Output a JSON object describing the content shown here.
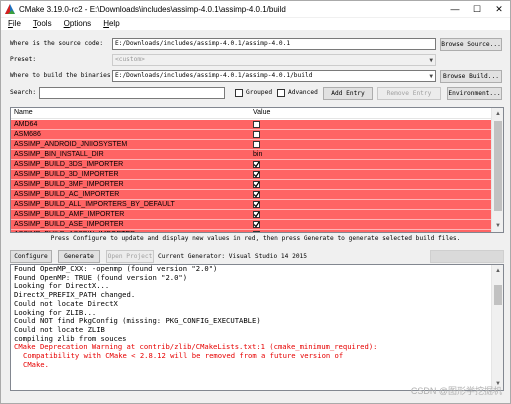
{
  "window": {
    "title": "CMake 3.19.0-rc2 - E:\\Downloads\\includes\\assimp-4.0.1\\assimp-4.0.1/build",
    "minimize": "—",
    "maximize": "☐",
    "close": "✕"
  },
  "menu": [
    {
      "label": "File",
      "key": "F",
      "rest": "ile"
    },
    {
      "label": "Tools",
      "key": "T",
      "rest": "ools"
    },
    {
      "label": "Options",
      "key": "O",
      "rest": "ptions"
    },
    {
      "label": "Help",
      "key": "H",
      "rest": "elp"
    }
  ],
  "source": {
    "label": "Where is the source code:",
    "value": "E:/Downloads/includes/assimp-4.0.1/assimp-4.0.1",
    "browse": "Browse Source..."
  },
  "preset": {
    "label": "Preset:",
    "value": "<custom>"
  },
  "build": {
    "label": "Where to build the binaries:",
    "value": "E:/Downloads/includes/assimp-4.0.1/assimp-4.0.1/build",
    "browse": "Browse Build..."
  },
  "search": {
    "label": "Search:",
    "value": "",
    "grouped": "Grouped",
    "advanced": "Advanced",
    "add_entry": "Add Entry",
    "remove_entry": "Remove Entry",
    "environment": "Environment..."
  },
  "table": {
    "col_name": "Name",
    "col_value": "Value",
    "rows": [
      {
        "name": "AMD64",
        "type": "check",
        "checked": false
      },
      {
        "name": "ASM686",
        "type": "check",
        "checked": false
      },
      {
        "name": "ASSIMP_ANDROID_JNIIOSYSTEM",
        "type": "check",
        "checked": false
      },
      {
        "name": "ASSIMP_BIN_INSTALL_DIR",
        "type": "text",
        "value": "bin"
      },
      {
        "name": "ASSIMP_BUILD_3DS_IMPORTER",
        "type": "check",
        "checked": true
      },
      {
        "name": "ASSIMP_BUILD_3D_IMPORTER",
        "type": "check",
        "checked": true
      },
      {
        "name": "ASSIMP_BUILD_3MF_IMPORTER",
        "type": "check",
        "checked": true
      },
      {
        "name": "ASSIMP_BUILD_AC_IMPORTER",
        "type": "check",
        "checked": true
      },
      {
        "name": "ASSIMP_BUILD_ALL_IMPORTERS_BY_DEFAULT",
        "type": "check",
        "checked": true
      },
      {
        "name": "ASSIMP_BUILD_AMF_IMPORTER",
        "type": "check",
        "checked": true
      },
      {
        "name": "ASSIMP_BUILD_ASE_IMPORTER",
        "type": "check",
        "checked": true
      },
      {
        "name": "ASSIMP_BUILD_ASSBIN_IMPORTER",
        "type": "check",
        "checked": true
      }
    ],
    "row_color": "#ff6464"
  },
  "hint": "Press Configure to update and display new values in red, then press Generate to generate selected build files.",
  "actions": {
    "configure": "Configure",
    "generate": "Generate",
    "open_project": "Open Project",
    "generator": "Current Generator: Visual Studio 14 2015"
  },
  "log": [
    {
      "text": "Found OpenMP_CXX: -openmp (found version \"2.0\")",
      "red": false,
      "indent": false
    },
    {
      "text": "Found OpenMP: TRUE (found version \"2.0\")",
      "red": false,
      "indent": false
    },
    {
      "text": "Looking for DirectX...",
      "red": false,
      "indent": false
    },
    {
      "text": "DirectX_PREFIX_PATH changed.",
      "red": false,
      "indent": false
    },
    {
      "text": "Could not locate DirectX",
      "red": false,
      "indent": false
    },
    {
      "text": "Looking for ZLIB...",
      "red": false,
      "indent": false
    },
    {
      "text": "Could NOT find PkgConfig (missing: PKG_CONFIG_EXECUTABLE)",
      "red": false,
      "indent": false
    },
    {
      "text": "Could not locate ZLIB",
      "red": false,
      "indent": false
    },
    {
      "text": "compiling zlib from souces",
      "red": false,
      "indent": false
    },
    {
      "text": "CMake Deprecation Warning at contrib/zlib/CMakeLists.txt:1 (cmake_minimum_required):",
      "red": true,
      "indent": false
    },
    {
      "text": "Compatibility with CMake < 2.8.12 will be removed from a future version of",
      "red": true,
      "indent": true
    },
    {
      "text": "CMake.",
      "red": true,
      "indent": true
    }
  ],
  "watermark": "CSDN @图形学挖掘机"
}
